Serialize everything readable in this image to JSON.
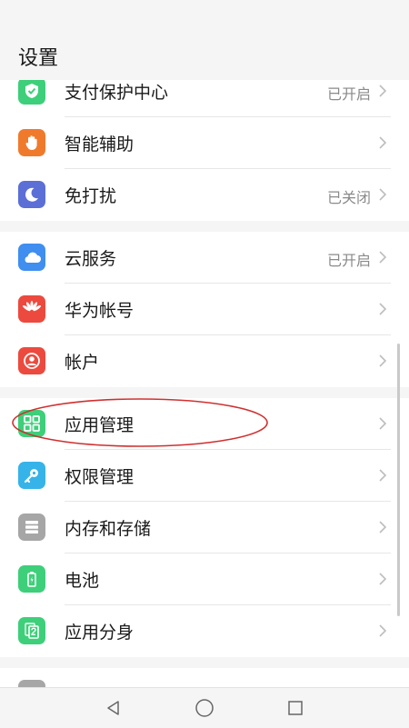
{
  "header": {
    "title": "设置"
  },
  "groups": [
    {
      "items": [
        {
          "label": "支付保护中心",
          "status": "已开启",
          "icon": "shield-check-icon",
          "color": "#3ecf7a"
        },
        {
          "label": "智能辅助",
          "status": "",
          "icon": "hand-icon",
          "color": "#f07a2c"
        },
        {
          "label": "免打扰",
          "status": "已关闭",
          "icon": "moon-icon",
          "color": "#5b6fd6"
        }
      ]
    },
    {
      "items": [
        {
          "label": "云服务",
          "status": "已开启",
          "icon": "cloud-icon",
          "color": "#3f8ef0"
        },
        {
          "label": "华为帐号",
          "status": "",
          "icon": "huawei-logo-icon",
          "color": "#ec4a3e"
        },
        {
          "label": "帐户",
          "status": "",
          "icon": "user-icon",
          "color": "#ec4a3e"
        }
      ]
    },
    {
      "items": [
        {
          "label": "应用管理",
          "status": "",
          "icon": "app-grid-icon",
          "color": "#3ecf7a"
        },
        {
          "label": "权限管理",
          "status": "",
          "icon": "key-icon",
          "color": "#36b3e8"
        },
        {
          "label": "内存和存储",
          "status": "",
          "icon": "storage-icon",
          "color": "#a6a6a6"
        },
        {
          "label": "电池",
          "status": "",
          "icon": "battery-icon",
          "color": "#3ecf7a"
        },
        {
          "label": "应用分身",
          "status": "",
          "icon": "app-twin-icon",
          "color": "#3ecf7a"
        }
      ]
    }
  ],
  "annotation": {
    "color": "#d03030"
  },
  "navbar": {
    "buttons": [
      "back-icon",
      "home-icon",
      "recents-icon"
    ]
  }
}
